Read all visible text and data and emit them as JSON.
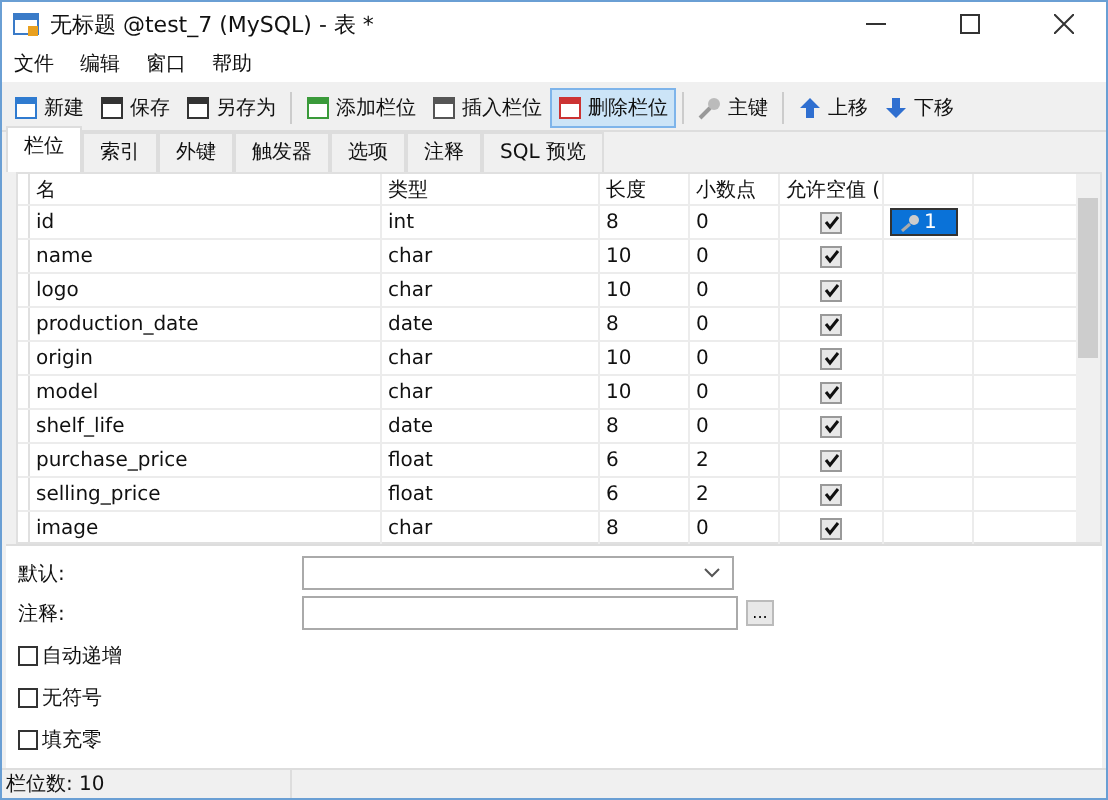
{
  "window": {
    "title": "无标题 @test_7 (MySQL) - 表 *"
  },
  "menu": [
    "文件",
    "编辑",
    "窗口",
    "帮助"
  ],
  "toolbar": [
    {
      "kind": "button",
      "label": "新建",
      "active": false
    },
    {
      "kind": "button",
      "label": "保存",
      "active": false
    },
    {
      "kind": "button",
      "label": "另存为",
      "active": false
    },
    {
      "kind": "separator"
    },
    {
      "kind": "button",
      "label": "添加栏位",
      "active": false
    },
    {
      "kind": "button",
      "label": "插入栏位",
      "active": false
    },
    {
      "kind": "button",
      "label": "删除栏位",
      "active": true
    },
    {
      "kind": "separator"
    },
    {
      "kind": "button",
      "label": "主键",
      "active": false
    },
    {
      "kind": "separator"
    },
    {
      "kind": "button",
      "label": "上移",
      "active": false
    },
    {
      "kind": "button",
      "label": "下移",
      "active": false
    }
  ],
  "tabs": [
    {
      "label": "栏位",
      "selected": true
    },
    {
      "label": "索引",
      "selected": false
    },
    {
      "label": "外键",
      "selected": false
    },
    {
      "label": "触发器",
      "selected": false
    },
    {
      "label": "选项",
      "selected": false
    },
    {
      "label": "注释",
      "selected": false
    },
    {
      "label": "SQL 预览",
      "selected": false
    }
  ],
  "table": {
    "columns": [
      "名",
      "类型",
      "长度",
      "小数点",
      "允许空值 ("
    ],
    "rows": [
      {
        "name": "id",
        "type": "int",
        "length": "8",
        "decimals": "0",
        "nullable": true,
        "key": "1"
      },
      {
        "name": "name",
        "type": "char",
        "length": "10",
        "decimals": "0",
        "nullable": true
      },
      {
        "name": "logo",
        "type": "char",
        "length": "10",
        "decimals": "0",
        "nullable": true
      },
      {
        "name": "production_date",
        "type": "date",
        "length": "8",
        "decimals": "0",
        "nullable": true
      },
      {
        "name": "origin",
        "type": "char",
        "length": "10",
        "decimals": "0",
        "nullable": true
      },
      {
        "name": "model",
        "type": "char",
        "length": "10",
        "decimals": "0",
        "nullable": true
      },
      {
        "name": "shelf_life",
        "type": "date",
        "length": "8",
        "decimals": "0",
        "nullable": true
      },
      {
        "name": "purchase_price",
        "type": "float",
        "length": "6",
        "decimals": "2",
        "nullable": true
      },
      {
        "name": "selling_price",
        "type": "float",
        "length": "6",
        "decimals": "2",
        "nullable": true
      },
      {
        "name": "image",
        "type": "char",
        "length": "8",
        "decimals": "0",
        "nullable": true
      }
    ]
  },
  "properties": {
    "default_label": "默认:",
    "comment_label": "注释:",
    "comment_button": "...",
    "options": [
      {
        "label": "自动递增",
        "checked": false
      },
      {
        "label": "无符号",
        "checked": false
      },
      {
        "label": "填充零",
        "checked": false
      }
    ]
  },
  "status_bar": "栏位数: 10"
}
